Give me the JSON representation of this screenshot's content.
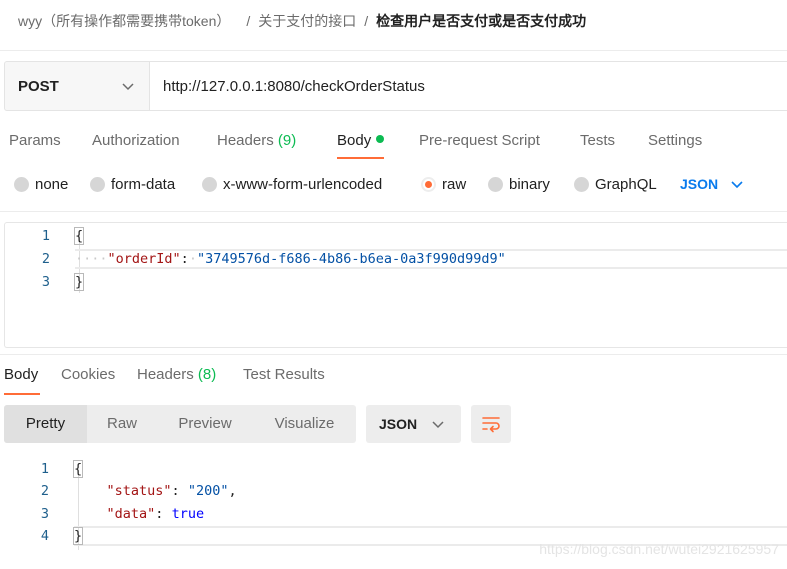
{
  "breadcrumb": {
    "workspace": "wyy（所有操作都需要携带token）",
    "collection": "关于支付的接口",
    "request": "检查用户是否支付或是否支付成功",
    "separator": "/"
  },
  "request": {
    "method": "POST",
    "url": "http://127.0.0.1:8080/checkOrderStatus"
  },
  "request_tabs": {
    "params": "Params",
    "authorization": "Authorization",
    "headers": "Headers",
    "headers_count": "(9)",
    "body": "Body",
    "prerequest": "Pre-request Script",
    "tests": "Tests",
    "settings": "Settings"
  },
  "body_types": {
    "none": "none",
    "form_data": "form-data",
    "urlencoded": "x-www-form-urlencoded",
    "raw": "raw",
    "binary": "binary",
    "graphql": "GraphQL",
    "selected": "raw",
    "language": "JSON"
  },
  "request_body": {
    "line_numbers": [
      "1",
      "2",
      "3"
    ],
    "open_brace": "{",
    "indent_dots": "····",
    "key": "\"orderId\"",
    "colon": ":",
    "value": "\"3749576d-f686-4b86-b6ea-0a3f990d99d9\"",
    "close_brace": "}"
  },
  "response_tabs": {
    "body": "Body",
    "cookies": "Cookies",
    "headers": "Headers",
    "headers_count": "(8)",
    "test_results": "Test Results"
  },
  "response_view": {
    "pretty": "Pretty",
    "raw": "Raw",
    "preview": "Preview",
    "visualize": "Visualize",
    "language": "JSON"
  },
  "response_body": {
    "line_numbers": [
      "1",
      "2",
      "3",
      "4"
    ],
    "open_brace": "{",
    "status_key": "\"status\"",
    "status_value": "\"200\"",
    "data_key": "\"data\"",
    "data_value": "true",
    "close_brace": "}"
  },
  "watermark": "https://blog.csdn.net/wutei2921625957",
  "colors": {
    "accent": "#ff6c37",
    "count_green": "#0cbb52",
    "link_blue": "#097bed",
    "json_key": "#a31515",
    "json_string": "#0451a5",
    "json_keyword": "#0000ff"
  }
}
